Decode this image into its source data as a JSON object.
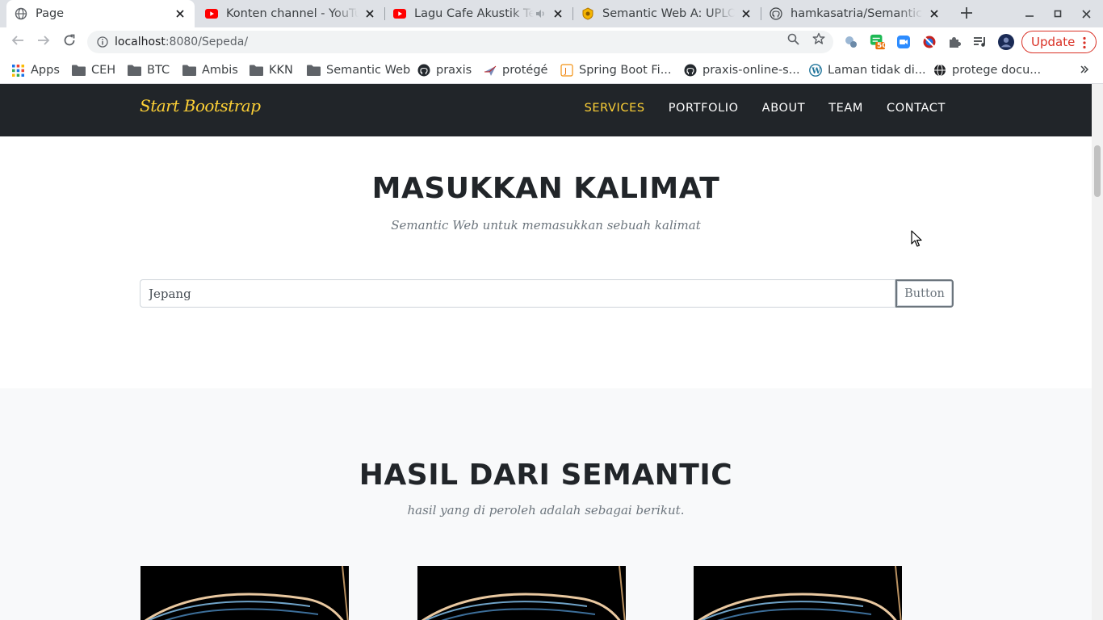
{
  "browser": {
    "tabs": [
      {
        "title": "Page",
        "icon": "globe-icon",
        "active": true
      },
      {
        "title": "Konten channel - YouTube",
        "icon": "youtube-icon",
        "active": false
      },
      {
        "title": "Lagu Cafe Akustik Terbaru",
        "icon": "youtube-icon",
        "active": false
      },
      {
        "title": "Semantic Web A: UPLOAD",
        "icon": "moodle-icon",
        "active": false
      },
      {
        "title": "hamkasatria/Semantic-Web",
        "icon": "github-icon",
        "active": false
      }
    ],
    "new_tab_icon": "plus-icon",
    "address": {
      "host": "localhost",
      "path": ":8080/Sepeda/"
    },
    "update_label": "Update",
    "bookmarks": [
      {
        "label": "Apps",
        "icon": "apps-grid-icon"
      },
      {
        "label": "CEH",
        "icon": "folder-icon"
      },
      {
        "label": "BTC",
        "icon": "folder-icon"
      },
      {
        "label": "Ambis",
        "icon": "folder-icon"
      },
      {
        "label": "KKN",
        "icon": "folder-icon"
      },
      {
        "label": "Semantic Web",
        "icon": "folder-icon"
      },
      {
        "label": "praxis",
        "icon": "github-icon"
      },
      {
        "label": "protégé",
        "icon": "protege-icon"
      },
      {
        "label": "Spring Boot Fi...",
        "icon": "spring-icon"
      },
      {
        "label": "praxis-online-s...",
        "icon": "github-icon"
      },
      {
        "label": "Laman tidak di...",
        "icon": "wordpress-icon"
      },
      {
        "label": "protege docu...",
        "icon": "globe-icon"
      }
    ],
    "ext_badge": "50"
  },
  "site": {
    "brand": "Start Bootstrap",
    "nav": [
      {
        "label": "SERVICES",
        "active": true
      },
      {
        "label": "PORTFOLIO",
        "active": false
      },
      {
        "label": "ABOUT",
        "active": false
      },
      {
        "label": "TEAM",
        "active": false
      },
      {
        "label": "CONTACT",
        "active": false
      }
    ],
    "input_section": {
      "heading": "MASUKKAN KALIMAT",
      "subheading": "Semantic Web untuk memasukkan sebuah kalimat",
      "input_value": "Jepang",
      "button_label": "Button"
    },
    "result_section": {
      "heading": "HASIL DARI SEMANTIC",
      "subheading": "hasil yang di peroleh adalah sebagai berikut."
    }
  },
  "colors": {
    "nav_bg": "#212529",
    "accent": "#fed136",
    "update_red": "#d93025"
  }
}
